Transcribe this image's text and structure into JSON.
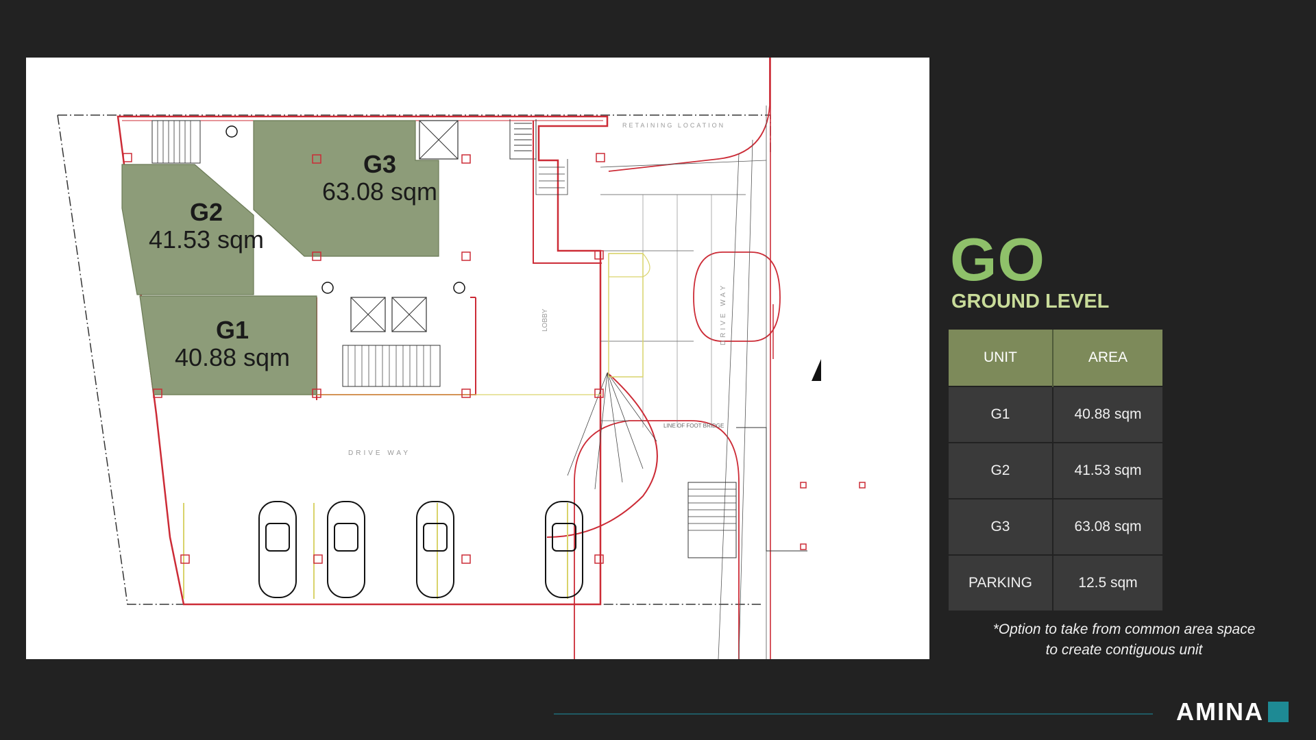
{
  "plan": {
    "units": [
      {
        "code": "G3",
        "area": "63.08 sqm"
      },
      {
        "code": "G2",
        "area": "41.53 sqm"
      },
      {
        "code": "G1",
        "area": "40.88 sqm"
      }
    ],
    "annotations": {
      "lobby": "LOBBY",
      "drive_way_left": "DRIVE WAY",
      "drive_way_right": "DRIVE WAY",
      "retaining": "RETAINING LOCATION",
      "footbridge": "LINE OF FOOT BRIDGE"
    }
  },
  "level": {
    "code": "GO",
    "name": "GROUND LEVEL"
  },
  "table": {
    "headers": [
      "UNIT",
      "AREA"
    ],
    "rows": [
      [
        "G1",
        "40.88 sqm"
      ],
      [
        "G2",
        "41.53 sqm"
      ],
      [
        "G3",
        "63.08 sqm"
      ],
      [
        "PARKING",
        "12.5 sqm"
      ]
    ]
  },
  "footnote": {
    "line1": "*Option to take from common area space",
    "line2": "to create contiguous unit"
  },
  "brand": {
    "name": "AMINA"
  },
  "colors": {
    "accent_green": "#8fc16a",
    "unit_fill": "#8d9c79",
    "teal": "#1e8a94"
  }
}
